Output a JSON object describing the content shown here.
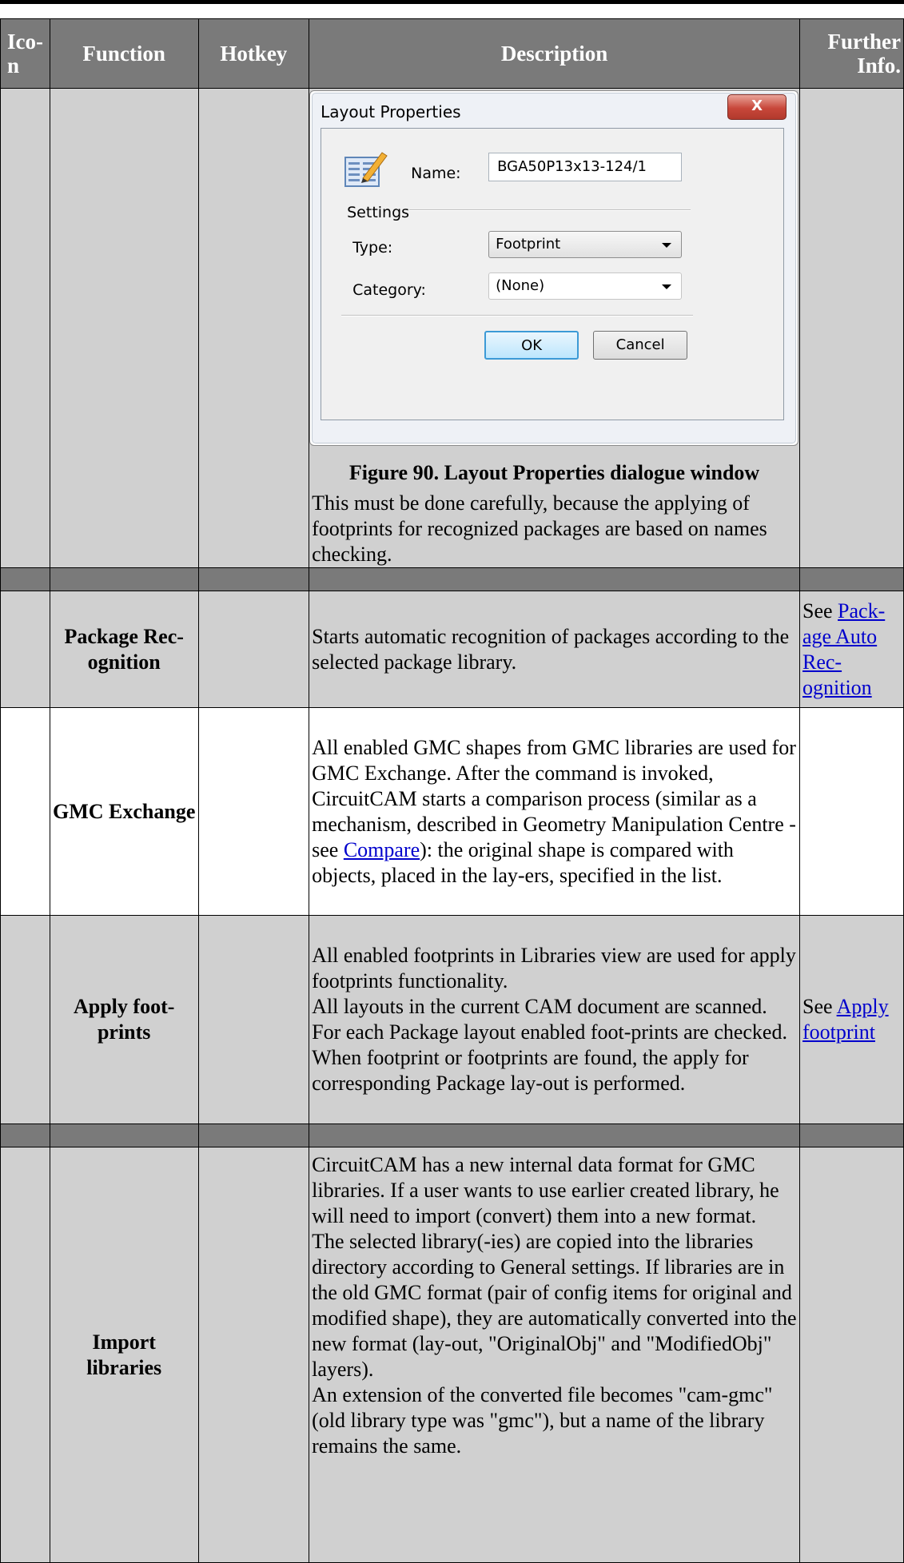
{
  "columns": {
    "icon": "Ico-n",
    "function": "Function",
    "hotkey": "Hotkey",
    "description": "Description",
    "further_info": "Further Info."
  },
  "dialog": {
    "title": "Layout Properties",
    "close_glyph": "X",
    "name_label": "Name:",
    "name_value": "BGA50P13x13-124/1",
    "settings_label": "Settings",
    "type_label": "Type:",
    "type_value": "Footprint",
    "category_label": "Category:",
    "category_value": "(None)",
    "ok_label": "OK",
    "cancel_label": "Cancel"
  },
  "row1": {
    "caption": "Figure 90. Layout Properties dialogue window",
    "text": "This must be done carefully, because the applying of footprints for recognized packages are based on names checking."
  },
  "row2": {
    "function": "Package Rec-ognition",
    "description": "Starts automatic recognition of packages according to the selected package library.",
    "info_prefix": "See ",
    "info_link": "Pack-age Auto Rec-ognition"
  },
  "row3": {
    "function": "GMC Exchange",
    "description_before": "All enabled GMC shapes from GMC libraries are used for GMC Exchange. After the command is invoked, CircuitCAM starts a comparison process (similar as a mechanism, described in Geometry Manipulation Centre - see ",
    "description_link": "Compare",
    "description_after": "): the original shape is compared with objects, placed in the lay-ers, specified in the list."
  },
  "row4": {
    "function": "Apply foot-prints",
    "description_p1": "All enabled footprints in Libraries view are used for apply footprints functionality.",
    "description_p2": "All layouts in the current CAM document are scanned. For each Package layout enabled foot-prints are checked. When footprint or footprints are found, the apply for corresponding Package lay-out is performed.",
    "info_prefix": "See ",
    "info_link": "Apply footprint"
  },
  "row5": {
    "function": "Import libraries",
    "description_p1": "CircuitCAM has a new internal data format for GMC libraries. If a user wants to use earlier created library, he will need to import (convert) them into a new format.",
    "description_p2": "The selected library(-ies) are copied into the libraries directory according to General settings. If libraries are in the old GMC format (pair of config items for original and modified shape), they are automatically converted into the new format (lay-out, \"OriginalObj\" and \"ModifiedObj\" layers).",
    "description_p3": "An extension of the converted file becomes \"cam-gmc\" (old library type was \"gmc\"), but a name of the library remains the same."
  },
  "colors": {
    "header_bg": "#7a7a7a",
    "row_gray": "#d0d0d0",
    "link": "#0000cc"
  }
}
